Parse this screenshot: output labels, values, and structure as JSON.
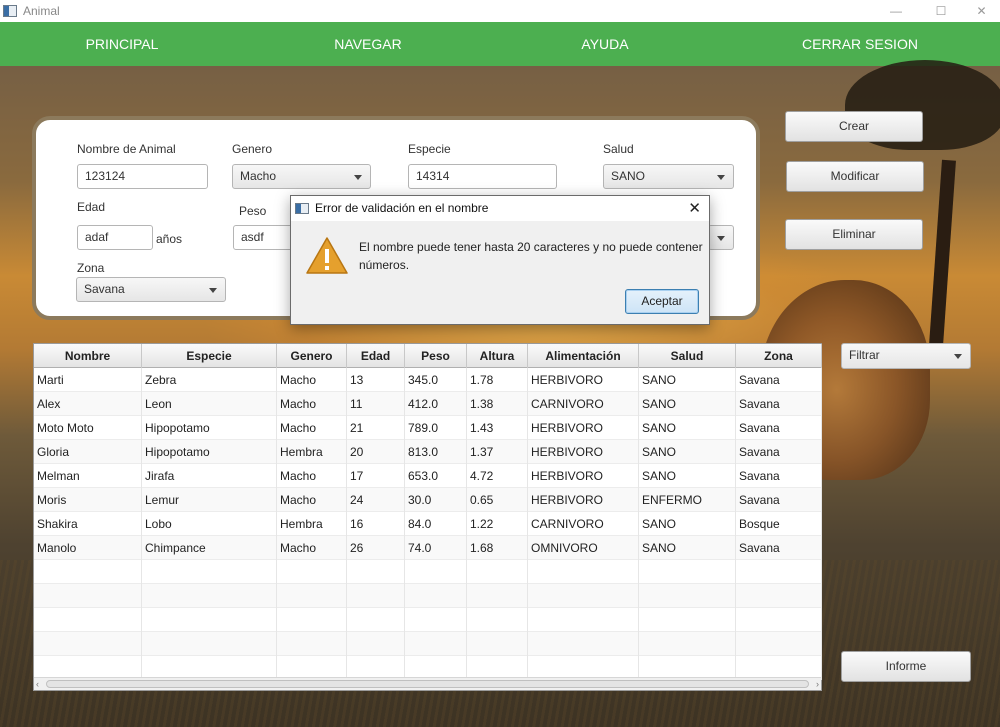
{
  "window": {
    "title": "Animal"
  },
  "menu": [
    {
      "label": "PRINCIPAL"
    },
    {
      "label": "NAVEGAR"
    },
    {
      "label": "AYUDA"
    },
    {
      "label": "CERRAR SESION"
    }
  ],
  "form": {
    "nombre_label": "Nombre de Animal",
    "nombre_value": "123124",
    "genero_label": "Genero",
    "genero_value": "Macho",
    "especie_label": "Especie",
    "especie_value": "14314",
    "salud_label": "Salud",
    "salud_value": "SANO",
    "edad_label": "Edad",
    "edad_value": "adaf",
    "edad_unit": "años",
    "peso_label": "Peso",
    "peso_value": "asdf",
    "zona_label": "Zona",
    "zona_value": "Savana"
  },
  "actions": {
    "crear": "Crear",
    "modificar": "Modificar",
    "eliminar": "Eliminar",
    "filtrar": "Filtrar",
    "informe": "Informe"
  },
  "table": {
    "columns": [
      "Nombre",
      "Especie",
      "Genero",
      "Edad",
      "Peso",
      "Altura",
      "Alimentación",
      "Salud",
      "Zona"
    ],
    "rows": [
      [
        "Marti",
        "Zebra",
        "Macho",
        "13",
        "345.0",
        "1.78",
        "HERBIVORO",
        "SANO",
        "Savana"
      ],
      [
        "Alex",
        "Leon",
        "Macho",
        "11",
        "412.0",
        "1.38",
        "CARNIVORO",
        "SANO",
        "Savana"
      ],
      [
        "Moto Moto",
        "Hipopotamo",
        "Macho",
        "21",
        "789.0",
        "1.43",
        "HERBIVORO",
        "SANO",
        "Savana"
      ],
      [
        "Gloria",
        "Hipopotamo",
        "Hembra",
        "20",
        "813.0",
        "1.37",
        "HERBIVORO",
        "SANO",
        "Savana"
      ],
      [
        "Melman",
        "Jirafa",
        "Macho",
        "17",
        "653.0",
        "4.72",
        "HERBIVORO",
        "SANO",
        "Savana"
      ],
      [
        "Moris",
        "Lemur",
        "Macho",
        "24",
        "30.0",
        "0.65",
        "HERBIVORO",
        "ENFERMO",
        "Savana"
      ],
      [
        "Shakira",
        "Lobo",
        "Hembra",
        "16",
        "84.0",
        "1.22",
        "CARNIVORO",
        "SANO",
        "Bosque"
      ],
      [
        "Manolo",
        "Chimpance",
        "Macho",
        "26",
        "74.0",
        "1.68",
        "OMNIVORO",
        "SANO",
        "Savana"
      ]
    ]
  },
  "dialog": {
    "title": "Error de validación en el nombre",
    "message": "El nombre puede tener hasta 20 caracteres y no puede contener números.",
    "button": "Aceptar",
    "icon": "warning-icon"
  },
  "colors": {
    "menu_bar": "#4caf50",
    "menu_text": "#ffffff",
    "panel_border": "#8c7a5c",
    "warning": "#e5a02d"
  }
}
